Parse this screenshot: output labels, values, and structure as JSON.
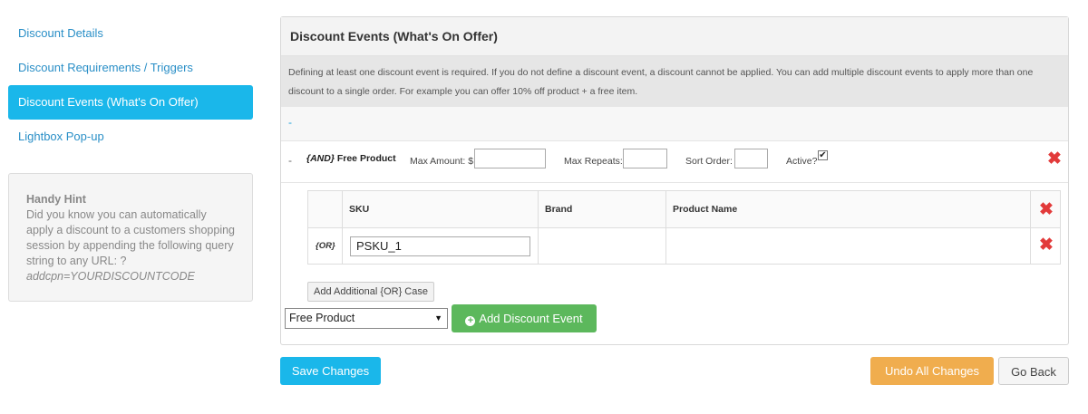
{
  "sidebar": {
    "items": [
      {
        "label": "Discount Details"
      },
      {
        "label": "Discount Requirements / Triggers"
      },
      {
        "label": "Discount Events (What's On Offer)"
      },
      {
        "label": "Lightbox Pop-up"
      }
    ],
    "hint": {
      "title": "Handy Hint",
      "text": "Did you know you can automatically apply a discount to a customers shopping session by appending the following query string to any URL: ?",
      "code": "addcpn=YOURDISCOUNTCODE"
    }
  },
  "panel": {
    "title": "Discount Events (What's On Offer)",
    "description": "Defining at least one discount event is required. If you do not define a discount event, a discount cannot be applied. You can add multiple discount events to apply more than one discount to a single order. For example you can offer 10% off product + a free item.",
    "dash": "-",
    "event": {
      "dash": "-",
      "and_label": "{AND}",
      "name": "Free Product",
      "max_amount_label": "Max Amount: $",
      "max_amount_value": "",
      "max_repeats_label": "Max Repeats:",
      "max_repeats_value": "",
      "sort_order_label": "Sort Order:",
      "sort_order_value": "",
      "active_label": "Active?",
      "active_checked": true,
      "active_mark": "✔"
    },
    "table": {
      "headers": [
        "SKU",
        "Brand",
        "Product Name"
      ],
      "rows": [
        {
          "or_label": "{OR}",
          "sku": "PSKU_1",
          "brand": "",
          "product_name": ""
        }
      ],
      "add_or_label": "Add Additional {OR} Case"
    },
    "event_type_select": "Free Product",
    "add_event_label": "Add Discount Event"
  },
  "footer": {
    "save_label": "Save Changes",
    "undo_label": "Undo All Changes",
    "back_label": "Go Back"
  },
  "colors": {
    "accent": "#1ab7ea",
    "success": "#5cb85c",
    "warning": "#f0ad4e",
    "danger": "#e23a3a"
  },
  "icons": {
    "delete": "close-icon",
    "add": "plus-circle-icon",
    "select": "caret-down-icon"
  }
}
